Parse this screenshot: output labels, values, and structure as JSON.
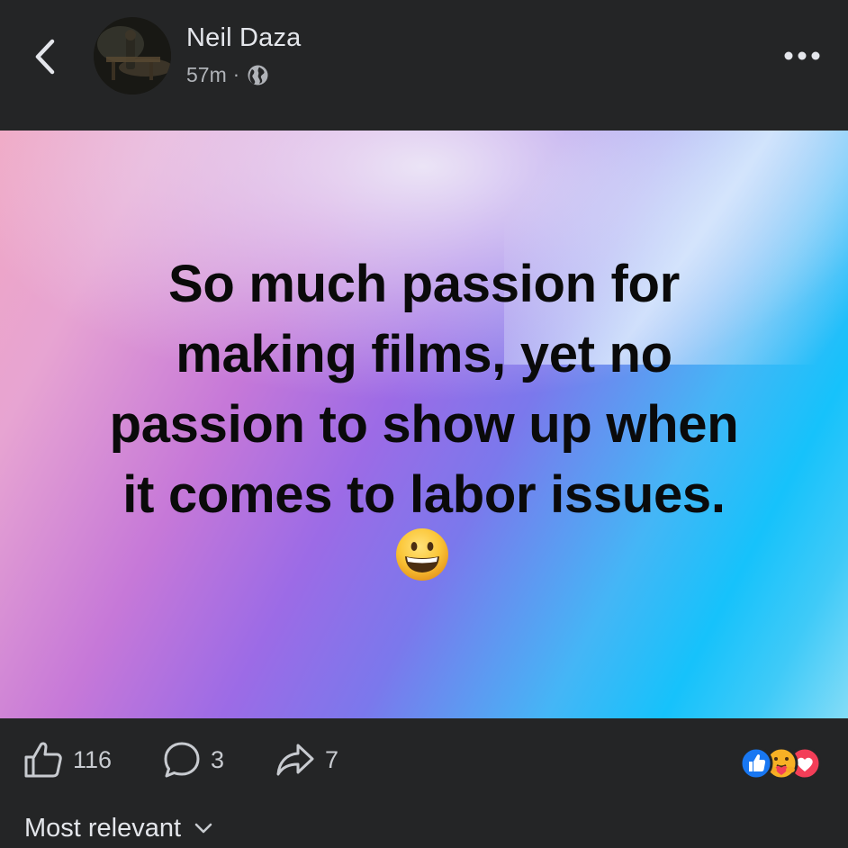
{
  "header": {
    "author_name": "Neil Daza",
    "time_ago": "57m",
    "separator": "·",
    "privacy_icon": "globe-icon",
    "back_icon": "chevron-left-icon",
    "more_icon": "more-horizontal-icon"
  },
  "post": {
    "lines": [
      "So much passion for",
      "making films, yet no",
      "passion to show up when",
      "it comes to labor issues."
    ],
    "emoji": "grinning-face-emoji"
  },
  "actions": {
    "like_count": "116",
    "comment_count": "3",
    "share_count": "7",
    "reaction_icons": [
      "like-reaction-icon",
      "care-reaction-icon",
      "love-reaction-icon"
    ]
  },
  "sort": {
    "label": "Most relevant"
  },
  "colors": {
    "background": "#242526",
    "text_primary": "#e4e6eb",
    "text_secondary": "#b0b3b8",
    "like_blue": "#1877f2",
    "love_red": "#f33e58",
    "care_yellow": "#f7b125"
  }
}
